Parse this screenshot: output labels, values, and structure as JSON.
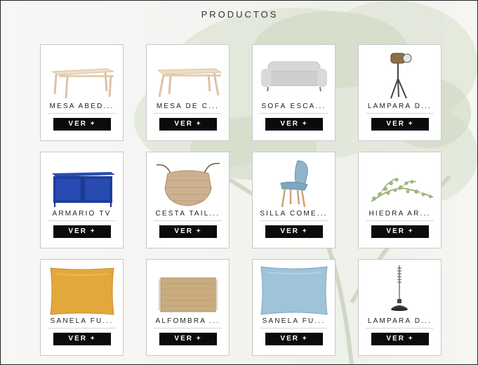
{
  "page": {
    "title": "PRODUCTOS"
  },
  "products": [
    {
      "name": "MESA ABED...",
      "button": "VER +",
      "icon": "table-icon"
    },
    {
      "name": "MESA DE C...",
      "button": "VER +",
      "icon": "bench-table-icon"
    },
    {
      "name": "SOFÁ ESCA...",
      "button": "VER +",
      "icon": "sofa-icon"
    },
    {
      "name": "LÁMPARA D...",
      "button": "VER +",
      "icon": "spotlight-lamp-icon"
    },
    {
      "name": "ARMARIO TV",
      "button": "VER +",
      "icon": "tv-cabinet-icon"
    },
    {
      "name": "CESTA TAIL...",
      "button": "VER +",
      "icon": "basket-icon"
    },
    {
      "name": "SILLA COME...",
      "button": "VER +",
      "icon": "chair-icon"
    },
    {
      "name": "HIEDRA AR...",
      "button": "VER +",
      "icon": "ivy-plant-icon"
    },
    {
      "name": "SANELA FU...",
      "button": "VER +",
      "icon": "yellow-cushion-icon"
    },
    {
      "name": "ALFOMBRA ...",
      "button": "VER +",
      "icon": "rug-icon"
    },
    {
      "name": "SANELA FU...",
      "button": "VER +",
      "icon": "blue-cushion-icon"
    },
    {
      "name": "LÁMPARA D...",
      "button": "VER +",
      "icon": "pendant-lamp-icon"
    }
  ],
  "colors": {
    "button_bg": "#0b0b0b",
    "button_text": "#ffffff",
    "card_border": "#c9c9c9"
  }
}
